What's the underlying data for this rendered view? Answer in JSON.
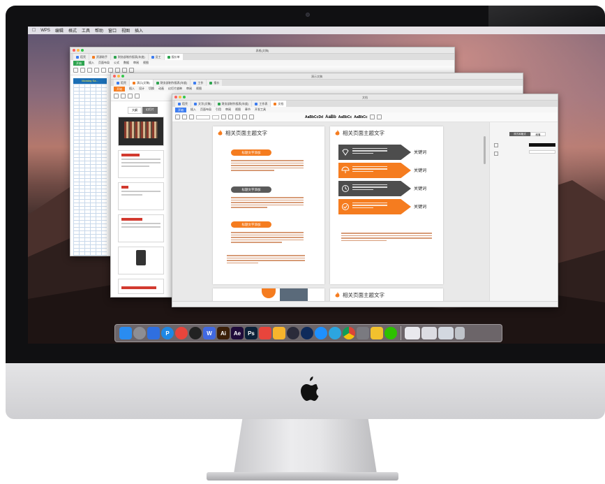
{
  "menubar": {
    "items": [
      "WPS",
      "编辑",
      "格式",
      "工具",
      "帮助",
      "窗口",
      "视图",
      "插入"
    ]
  },
  "spreadsheet_window": {
    "title": "表格(文稿)",
    "tabs": [
      "稻壳",
      "资源助手",
      "财务部制作报表(年度)",
      "员工",
      "报价单"
    ],
    "ribbon_tabs": [
      "开始",
      "插入",
      "页面布局",
      "公式",
      "数据",
      "审阅",
      "视图"
    ],
    "header_text": "Monday Sa..."
  },
  "slides_window": {
    "title": "演示文稿",
    "tabs": [
      "稻壳",
      "演示(文稿)",
      "财务部制作报表(年度)",
      "工作",
      "报价"
    ],
    "ribbon_tabs": [
      "开始",
      "插入",
      "设计",
      "切换",
      "动画",
      "幻灯片放映",
      "审阅",
      "视图"
    ],
    "panel_tabs": [
      "大纲",
      "幻灯片"
    ]
  },
  "doc_window": {
    "title": "文档",
    "tabs": [
      "稻壳",
      "文字(文稿)",
      "财务部制作报表(年度)",
      "工作表",
      "文档"
    ],
    "ribbon_tabs": [
      "开始",
      "插入",
      "页面布局",
      "引用",
      "审阅",
      "视图",
      "章节",
      "开发工具"
    ],
    "style_names": [
      "AaBbCcDd",
      "AaBb",
      "AaBbCc",
      "AaBbCc"
    ],
    "page_heading": "相关页面主题文字",
    "pill_label": "标题文字添加",
    "keyword": "关键词",
    "sidepanel_tabs": [
      "样式和格式",
      "段落"
    ]
  },
  "dock": {
    "icons": [
      {
        "name": "finder-icon",
        "label": "",
        "color": "#2a8cf0"
      },
      {
        "name": "launchpad-icon",
        "label": "",
        "color": "#8e8e93"
      },
      {
        "name": "baidu-netdisk-icon",
        "label": "",
        "color": "#2f6fe0"
      },
      {
        "name": "p-app-icon",
        "label": "P",
        "color": "#1e88e5"
      },
      {
        "name": "weibo-icon",
        "label": "",
        "color": "#e8453c"
      },
      {
        "name": "qq-icon",
        "label": "",
        "color": "#222222"
      },
      {
        "name": "wps-icon",
        "label": "W",
        "color": "#4169e1"
      },
      {
        "name": "illustrator-icon",
        "label": "Ai",
        "color": "#3b1f08"
      },
      {
        "name": "after-effects-icon",
        "label": "Ae",
        "color": "#1f0b3a"
      },
      {
        "name": "photoshop-icon",
        "label": "Ps",
        "color": "#0b2138"
      },
      {
        "name": "bar-chart-app-icon",
        "label": "",
        "color": "#e8453c"
      },
      {
        "name": "sketch-icon",
        "label": "",
        "color": "#f7b42c"
      },
      {
        "name": "quicktime-icon",
        "label": "",
        "color": "#2b2b3a"
      },
      {
        "name": "video-icon",
        "label": "",
        "color": "#0f2b5b"
      },
      {
        "name": "safari-icon",
        "label": "",
        "color": "#1e90ff"
      },
      {
        "name": "telegram-icon",
        "label": "",
        "color": "#2ca5e0"
      },
      {
        "name": "chrome-icon",
        "label": "",
        "color": "#e8eaed"
      },
      {
        "name": "system-preferences-icon",
        "label": "",
        "color": "#7a7a80"
      },
      {
        "name": "notes-app-icon",
        "label": "",
        "color": "#f2c12e"
      },
      {
        "name": "wechat-icon",
        "label": "",
        "color": "#2dc100"
      }
    ],
    "right_icons": [
      {
        "name": "downloads-stack-icon",
        "color": "#e9e9ee"
      },
      {
        "name": "screenshot-stack-icon",
        "color": "#dcdce2"
      },
      {
        "name": "window-preview-icon",
        "color": "#d3d8e0"
      },
      {
        "name": "trash-icon",
        "color": "#bfc3c9"
      }
    ]
  }
}
